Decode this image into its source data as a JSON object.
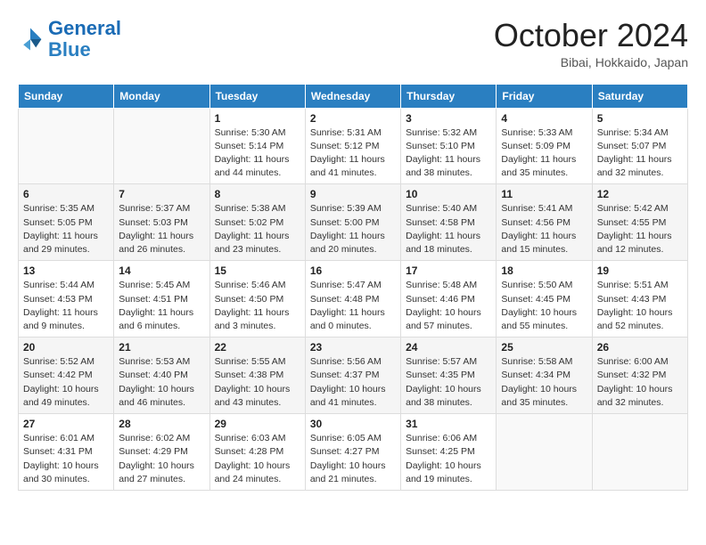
{
  "header": {
    "logo_line1": "General",
    "logo_line2": "Blue",
    "month": "October 2024",
    "location": "Bibai, Hokkaido, Japan"
  },
  "weekdays": [
    "Sunday",
    "Monday",
    "Tuesday",
    "Wednesday",
    "Thursday",
    "Friday",
    "Saturday"
  ],
  "weeks": [
    [
      {
        "num": "",
        "info": ""
      },
      {
        "num": "",
        "info": ""
      },
      {
        "num": "1",
        "info": "Sunrise: 5:30 AM\nSunset: 5:14 PM\nDaylight: 11 hours and 44 minutes."
      },
      {
        "num": "2",
        "info": "Sunrise: 5:31 AM\nSunset: 5:12 PM\nDaylight: 11 hours and 41 minutes."
      },
      {
        "num": "3",
        "info": "Sunrise: 5:32 AM\nSunset: 5:10 PM\nDaylight: 11 hours and 38 minutes."
      },
      {
        "num": "4",
        "info": "Sunrise: 5:33 AM\nSunset: 5:09 PM\nDaylight: 11 hours and 35 minutes."
      },
      {
        "num": "5",
        "info": "Sunrise: 5:34 AM\nSunset: 5:07 PM\nDaylight: 11 hours and 32 minutes."
      }
    ],
    [
      {
        "num": "6",
        "info": "Sunrise: 5:35 AM\nSunset: 5:05 PM\nDaylight: 11 hours and 29 minutes."
      },
      {
        "num": "7",
        "info": "Sunrise: 5:37 AM\nSunset: 5:03 PM\nDaylight: 11 hours and 26 minutes."
      },
      {
        "num": "8",
        "info": "Sunrise: 5:38 AM\nSunset: 5:02 PM\nDaylight: 11 hours and 23 minutes."
      },
      {
        "num": "9",
        "info": "Sunrise: 5:39 AM\nSunset: 5:00 PM\nDaylight: 11 hours and 20 minutes."
      },
      {
        "num": "10",
        "info": "Sunrise: 5:40 AM\nSunset: 4:58 PM\nDaylight: 11 hours and 18 minutes."
      },
      {
        "num": "11",
        "info": "Sunrise: 5:41 AM\nSunset: 4:56 PM\nDaylight: 11 hours and 15 minutes."
      },
      {
        "num": "12",
        "info": "Sunrise: 5:42 AM\nSunset: 4:55 PM\nDaylight: 11 hours and 12 minutes."
      }
    ],
    [
      {
        "num": "13",
        "info": "Sunrise: 5:44 AM\nSunset: 4:53 PM\nDaylight: 11 hours and 9 minutes."
      },
      {
        "num": "14",
        "info": "Sunrise: 5:45 AM\nSunset: 4:51 PM\nDaylight: 11 hours and 6 minutes."
      },
      {
        "num": "15",
        "info": "Sunrise: 5:46 AM\nSunset: 4:50 PM\nDaylight: 11 hours and 3 minutes."
      },
      {
        "num": "16",
        "info": "Sunrise: 5:47 AM\nSunset: 4:48 PM\nDaylight: 11 hours and 0 minutes."
      },
      {
        "num": "17",
        "info": "Sunrise: 5:48 AM\nSunset: 4:46 PM\nDaylight: 10 hours and 57 minutes."
      },
      {
        "num": "18",
        "info": "Sunrise: 5:50 AM\nSunset: 4:45 PM\nDaylight: 10 hours and 55 minutes."
      },
      {
        "num": "19",
        "info": "Sunrise: 5:51 AM\nSunset: 4:43 PM\nDaylight: 10 hours and 52 minutes."
      }
    ],
    [
      {
        "num": "20",
        "info": "Sunrise: 5:52 AM\nSunset: 4:42 PM\nDaylight: 10 hours and 49 minutes."
      },
      {
        "num": "21",
        "info": "Sunrise: 5:53 AM\nSunset: 4:40 PM\nDaylight: 10 hours and 46 minutes."
      },
      {
        "num": "22",
        "info": "Sunrise: 5:55 AM\nSunset: 4:38 PM\nDaylight: 10 hours and 43 minutes."
      },
      {
        "num": "23",
        "info": "Sunrise: 5:56 AM\nSunset: 4:37 PM\nDaylight: 10 hours and 41 minutes."
      },
      {
        "num": "24",
        "info": "Sunrise: 5:57 AM\nSunset: 4:35 PM\nDaylight: 10 hours and 38 minutes."
      },
      {
        "num": "25",
        "info": "Sunrise: 5:58 AM\nSunset: 4:34 PM\nDaylight: 10 hours and 35 minutes."
      },
      {
        "num": "26",
        "info": "Sunrise: 6:00 AM\nSunset: 4:32 PM\nDaylight: 10 hours and 32 minutes."
      }
    ],
    [
      {
        "num": "27",
        "info": "Sunrise: 6:01 AM\nSunset: 4:31 PM\nDaylight: 10 hours and 30 minutes."
      },
      {
        "num": "28",
        "info": "Sunrise: 6:02 AM\nSunset: 4:29 PM\nDaylight: 10 hours and 27 minutes."
      },
      {
        "num": "29",
        "info": "Sunrise: 6:03 AM\nSunset: 4:28 PM\nDaylight: 10 hours and 24 minutes."
      },
      {
        "num": "30",
        "info": "Sunrise: 6:05 AM\nSunset: 4:27 PM\nDaylight: 10 hours and 21 minutes."
      },
      {
        "num": "31",
        "info": "Sunrise: 6:06 AM\nSunset: 4:25 PM\nDaylight: 10 hours and 19 minutes."
      },
      {
        "num": "",
        "info": ""
      },
      {
        "num": "",
        "info": ""
      }
    ]
  ]
}
